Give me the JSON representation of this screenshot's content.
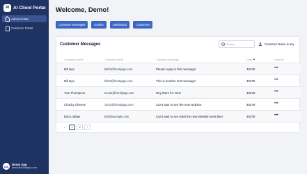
{
  "brand": {
    "logo": "AI",
    "name": "AI Client Portal"
  },
  "sidebar": {
    "items": [
      {
        "label": "Admin Portal",
        "icon": "house-icon",
        "active": true
      },
      {
        "label": "Customer Portal",
        "icon": "document-icon",
        "active": false
      }
    ]
  },
  "user": {
    "initials": "DA",
    "name": "Demo App",
    "email": "demo@frontlyapp.com"
  },
  "page": {
    "welcome": "Welcome, Demo!"
  },
  "quick_buttons": [
    "Customer Messages",
    "Guides",
    "Dashboard",
    "Customers"
  ],
  "messages_card": {
    "title": "Customer Messages",
    "search_placeholder": "Search",
    "filter_label": "Customer Name is any",
    "columns": [
      "Customer Name",
      "Customer Email",
      "Customer Message",
      "Date",
      "Actions"
    ],
    "rows": [
      {
        "name": "Bill Nye",
        "email": "bill22@frontlyapp.com",
        "message": "Please reply to this message!",
        "date": "45378"
      },
      {
        "name": "Bill Nye",
        "email": "bill23@frontlyapp.com",
        "message": "This is another test message!",
        "date": "45378"
      },
      {
        "name": "Tom Thompson",
        "email": "tom22@frontlyapp.com",
        "message": "Hey there it's Tom!",
        "date": "45378"
      },
      {
        "name": "Chucky Cheese",
        "email": "chuck@frontlyapp.com",
        "message": "Can't wait to see the new website.",
        "date": "45378"
      },
      {
        "name": "Bob Loblaw",
        "email": "bob@example.com",
        "message": "Can't wait to see what the new website looks like!",
        "date": "45378"
      }
    ],
    "pagination": {
      "prev": "‹",
      "pages": [
        "1",
        "2"
      ],
      "next": "›"
    }
  },
  "colors": {
    "sidebar": "#1f3362",
    "accent": "#3b66c4",
    "active_item": "#3b5390"
  }
}
